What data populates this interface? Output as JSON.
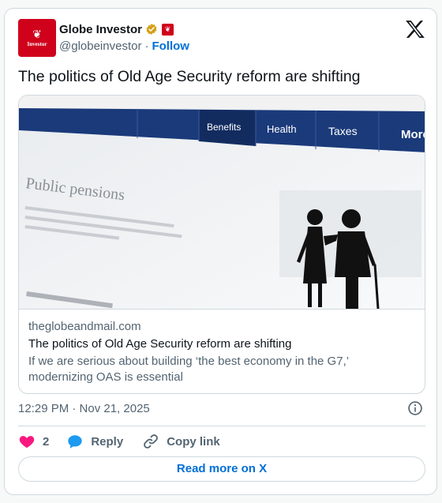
{
  "account": {
    "name": "Globe Investor",
    "handle": "@globeinvestor",
    "separator": "·",
    "follow_label": "Follow",
    "avatar_text": "Investor",
    "verified_badge_color": "#d4a017",
    "brand_color": "#d0021b",
    "avatar_icon": "maple-leaf-icon",
    "affiliate_icon": "maple-leaf-flag-icon"
  },
  "tweet": {
    "text": "The politics of Old Age Security reform are shifting",
    "timestamp": "12:29 PM · Nov 21, 2025"
  },
  "link_card": {
    "domain": "theglobeandmail.com",
    "title": "The politics of Old Age Security reform are shifting",
    "description": "If we are serious about building ‘the best economy in the G7,’ modernizing OAS is essential",
    "image": {
      "nav_items": [
        "Benefits",
        "Health",
        "Taxes",
        "More"
      ],
      "page_heading": "Public pensions",
      "nav_color": "#1a3a7a"
    }
  },
  "actions": {
    "like_count": "2",
    "reply_label": "Reply",
    "copy_label": "Copy link",
    "read_more_label": "Read more on X",
    "like_color": "#f91880",
    "reply_color": "#1d9bf0"
  }
}
